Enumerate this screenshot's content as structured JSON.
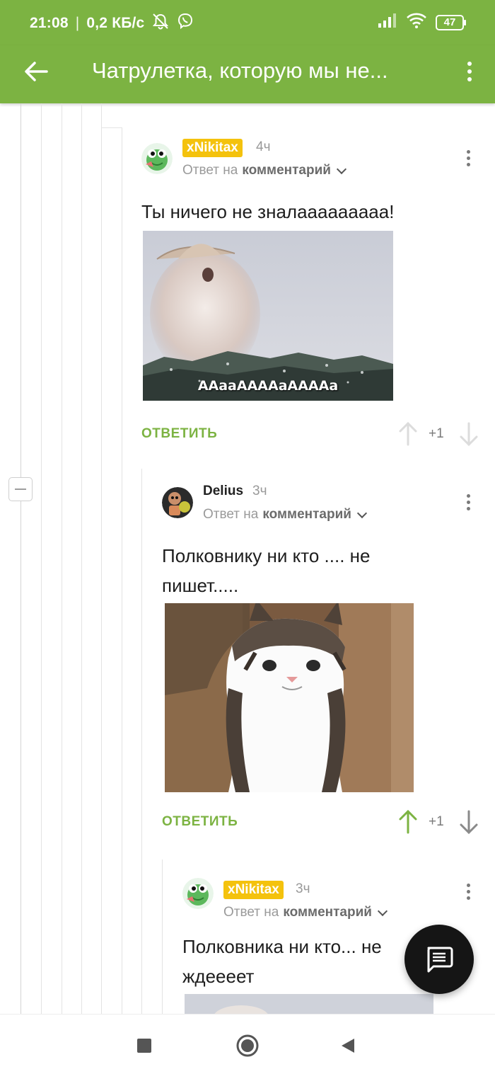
{
  "status_bar": {
    "time": "21:08",
    "separator": "|",
    "net_speed": "0,2 КБ/с",
    "battery": "47",
    "icons": [
      "bell-off-icon",
      "viber-icon",
      "signal-icon",
      "wifi-icon",
      "battery-icon"
    ]
  },
  "app_bar": {
    "title": "Чатрулетка, которую мы не...",
    "back_icon": "arrow-left-icon",
    "menu_icon": "more-vertical-icon"
  },
  "colors": {
    "accent": "#7cb342",
    "badge": "#f4c20d",
    "fab": "#151515"
  },
  "comments": [
    {
      "author": "xNikitax",
      "author_badge": true,
      "time": "4ч",
      "reply_prefix": "Ответ на",
      "reply_target": "комментарий",
      "text": "Ты ничего не зналааааааааа!",
      "image_caption": "ААааААААаААААа",
      "reply_label": "ОТВЕТИТЬ",
      "score": "+1",
      "upvoted": false
    },
    {
      "author": "Delius",
      "author_badge": false,
      "time": "3ч",
      "reply_prefix": "Ответ на",
      "reply_target": "комментарий",
      "text": "Полковнику ни кто .... не пишет.....",
      "reply_label": "ОТВЕТИТЬ",
      "score": "+1",
      "upvoted": true
    },
    {
      "author": "xNikitax",
      "author_badge": true,
      "time": "3ч",
      "reply_prefix": "Ответ на",
      "reply_target": "комментарий",
      "text": "Полковника ни кто... не ждеееет"
    }
  ],
  "fab": {
    "icon": "comment-icon"
  },
  "nav": {
    "icons": [
      "recents-square-icon",
      "home-circle-icon",
      "back-triangle-icon"
    ]
  }
}
